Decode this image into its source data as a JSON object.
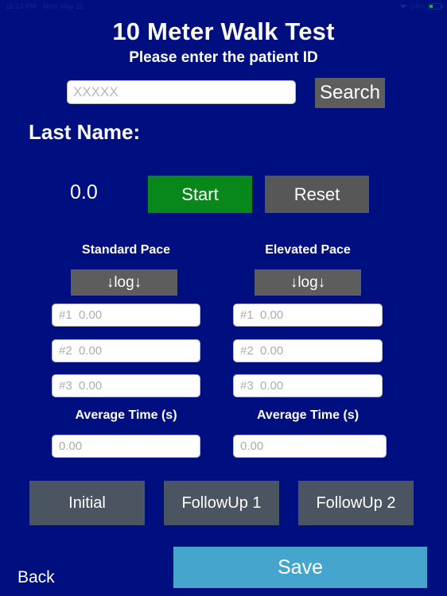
{
  "status_bar": {
    "time": "11:13 PM",
    "date": "Mon May 11",
    "battery_percent": "24%",
    "wifi_icon": "wifi-icon",
    "battery_icon": "battery-icon"
  },
  "header": {
    "title": "10 Meter Walk Test",
    "subtitle": "Please enter the patient ID"
  },
  "search": {
    "placeholder": "XXXXX",
    "value": "",
    "button_label": "Search"
  },
  "patient": {
    "last_name_label": "Last Name:"
  },
  "timer": {
    "value": "0.0",
    "start_label": "Start",
    "reset_label": "Reset",
    "start_color": "#08871b",
    "reset_color": "#575757"
  },
  "pace": {
    "standard": {
      "title": "Standard Pace",
      "log_label": "↓log↓",
      "trials": [
        {
          "placeholder": "#1  0.00",
          "value": ""
        },
        {
          "placeholder": "#2  0.00",
          "value": ""
        },
        {
          "placeholder": "#3  0.00",
          "value": ""
        }
      ],
      "average_label": "Average Time (s)",
      "average_placeholder": "0.00",
      "average_value": ""
    },
    "elevated": {
      "title": "Elevated Pace",
      "log_label": "↓log↓",
      "trials": [
        {
          "placeholder": "#1  0.00",
          "value": ""
        },
        {
          "placeholder": "#2  0.00",
          "value": ""
        },
        {
          "placeholder": "#3  0.00",
          "value": ""
        }
      ],
      "average_label": "Average Time (s)",
      "average_placeholder": "0.00",
      "average_value": ""
    }
  },
  "visits": [
    {
      "label": "Initial"
    },
    {
      "label": "FollowUp 1"
    },
    {
      "label": "FollowUp 2"
    }
  ],
  "footer": {
    "save_label": "Save",
    "back_label": "Back",
    "save_color": "#45a5cd"
  },
  "theme": {
    "background": "#000f80",
    "button_gray": "#5d5d5d",
    "visit_gray": "#4b5561"
  }
}
